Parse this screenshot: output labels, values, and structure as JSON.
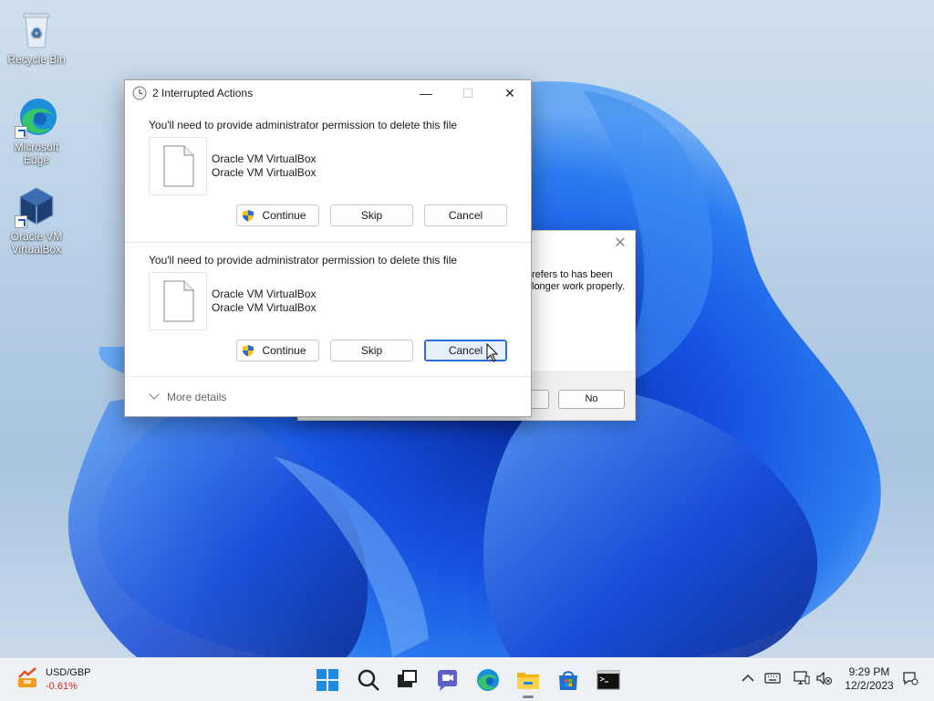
{
  "desktop": {
    "icons": [
      {
        "label": "Recycle Bin"
      },
      {
        "label": "Microsoft Edge"
      },
      {
        "label": "Oracle VM VirtualBox"
      }
    ]
  },
  "background_dialog": {
    "message_line1": "refers to has been",
    "message_line2": "longer work properly.",
    "no_label": "No"
  },
  "dialog": {
    "title": "2 Interrupted Actions",
    "minimize_icon": "minimize-icon",
    "maximize_icon": "maximize-icon",
    "close_icon": "close-icon",
    "actions": [
      {
        "message": "You'll need to provide administrator permission to delete this file",
        "file_name": "Oracle VM VirtualBox",
        "file_type": "Oracle VM VirtualBox",
        "continue_label": "Continue",
        "skip_label": "Skip",
        "cancel_label": "Cancel"
      },
      {
        "message": "You'll need to provide administrator permission to delete this file",
        "file_name": "Oracle VM VirtualBox",
        "file_type": "Oracle VM VirtualBox",
        "continue_label": "Continue",
        "skip_label": "Skip",
        "cancel_label": "Cancel"
      }
    ],
    "more_details_label": "More details"
  },
  "taskbar": {
    "widget": {
      "title": "USD/GBP",
      "value": "-0.61%"
    },
    "apps": [
      "start-icon",
      "search-icon",
      "task-view-icon",
      "chat-icon",
      "edge-icon",
      "file-explorer-icon",
      "store-icon",
      "terminal-icon"
    ],
    "clock": {
      "time": "9:29 PM",
      "date": "12/2/2023"
    }
  },
  "colors": {
    "accent": "#2a6fd6",
    "negative": "#c42b1c"
  }
}
